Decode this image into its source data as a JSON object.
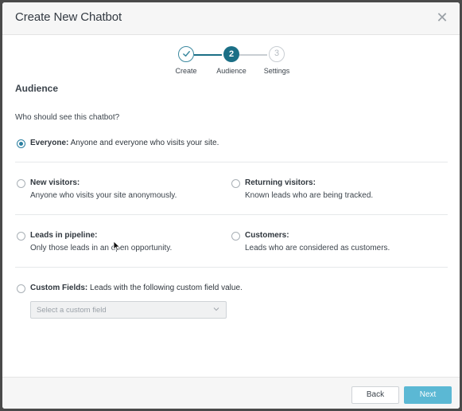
{
  "modal": {
    "title": "Create New Chatbot",
    "close_glyph": "✕"
  },
  "stepper": {
    "steps": [
      {
        "number": "1",
        "label": "Create",
        "state": "done",
        "icon": "check-icon"
      },
      {
        "number": "2",
        "label": "Audience",
        "state": "active"
      },
      {
        "number": "3",
        "label": "Settings",
        "state": "todo"
      }
    ]
  },
  "section": {
    "title": "Audience",
    "question": "Who should see this chatbot?"
  },
  "options": {
    "everyone": {
      "title": "Everyone:",
      "desc": "Anyone and everyone who visits your site.",
      "checked": true
    },
    "new_visitors": {
      "title": "New visitors:",
      "desc": "Anyone who visits your site anonymously.",
      "checked": false
    },
    "returning_visitors": {
      "title": "Returning visitors:",
      "desc": "Known leads who are being tracked.",
      "checked": false
    },
    "leads_in_pipeline": {
      "title": "Leads in pipeline:",
      "desc": "Only those leads in an open opportunity.",
      "checked": false
    },
    "customers": {
      "title": "Customers:",
      "desc": "Leads who are considered as customers.",
      "checked": false
    },
    "custom_fields": {
      "title": "Custom Fields:",
      "desc": "Leads with the following custom field value.",
      "checked": false
    }
  },
  "custom_field_select": {
    "placeholder": "Select a custom field"
  },
  "footer": {
    "back_label": "Back",
    "next_label": "Next"
  },
  "colors": {
    "accent": "#1b6f86",
    "next_button": "#5bb8d4",
    "radio_checked": "#2b7fa0"
  }
}
